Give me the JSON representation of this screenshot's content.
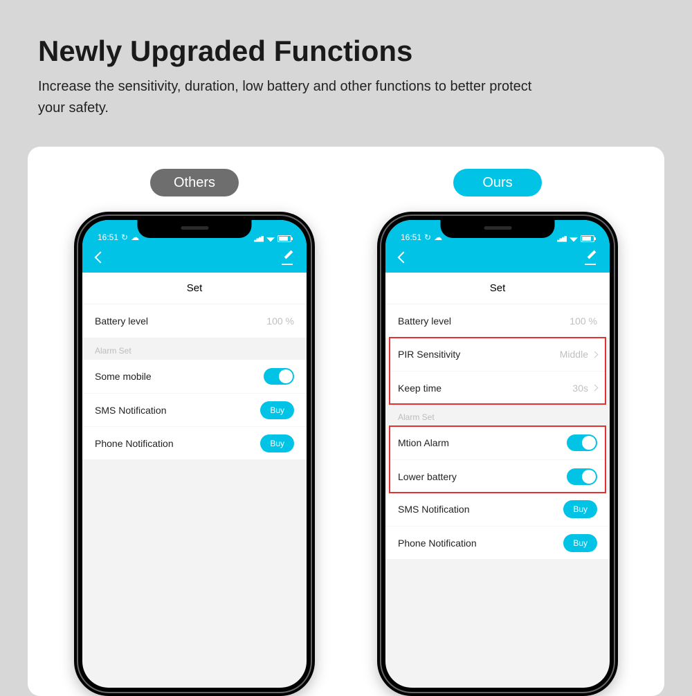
{
  "heading": "Newly Upgraded Functions",
  "subheading": "Increase the sensitivity, duration, low battery and other functions to better protect your safety.",
  "pills": {
    "others": "Others",
    "ours": "Ours"
  },
  "status_time": "16:51",
  "screen_title": "Set",
  "section_alarm": "Alarm Set",
  "buy_label": "Buy",
  "rows": {
    "battery_label": "Battery level",
    "battery_value": "100 %",
    "pir_label": "PIR Sensitivity",
    "pir_value": "Middle",
    "keep_label": "Keep time",
    "keep_value": "30s",
    "some_mobile": "Some mobile",
    "motion_alarm": "Mtion Alarm",
    "lower_battery": "Lower battery",
    "sms": "SMS Notification",
    "phone": "Phone Notification"
  }
}
